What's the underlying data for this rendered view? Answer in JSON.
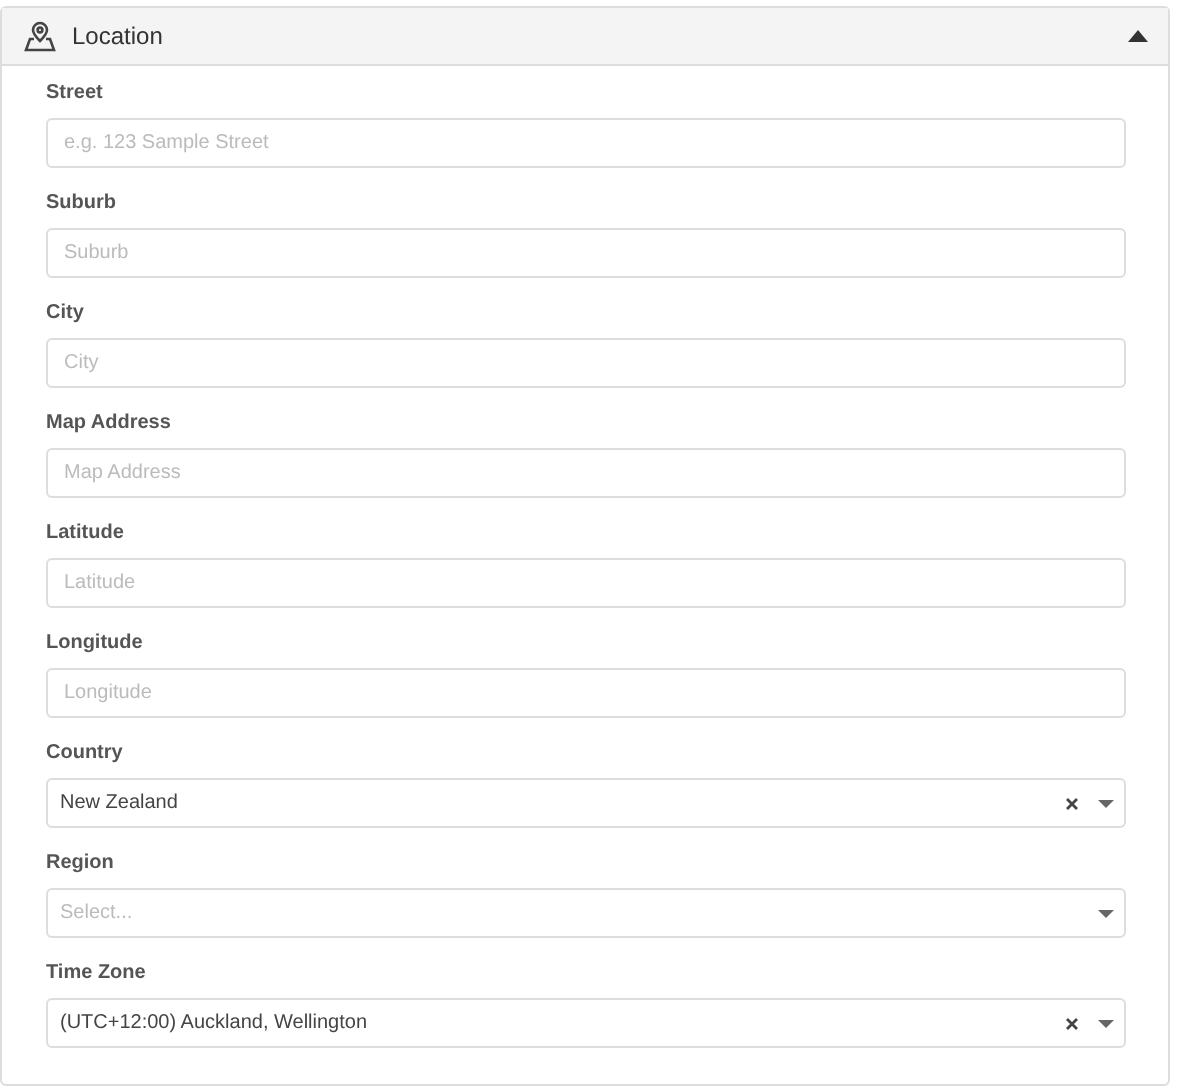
{
  "panel": {
    "title": "Location",
    "expanded": true
  },
  "fields": [
    {
      "kind": "text",
      "label": "Street",
      "placeholder": "e.g. 123 Sample Street"
    },
    {
      "kind": "text",
      "label": "Suburb",
      "placeholder": "Suburb"
    },
    {
      "kind": "text",
      "label": "City",
      "placeholder": "City"
    },
    {
      "kind": "text",
      "label": "Map Address",
      "placeholder": "Map Address"
    },
    {
      "kind": "text",
      "label": "Latitude",
      "placeholder": "Latitude"
    },
    {
      "kind": "text",
      "label": "Longitude",
      "placeholder": "Longitude"
    },
    {
      "kind": "select",
      "label": "Country",
      "value": "New Zealand",
      "clearable": true
    },
    {
      "kind": "select",
      "label": "Region",
      "placeholder": "Select...",
      "clearable": false
    },
    {
      "kind": "select",
      "label": "Time Zone",
      "value": "(UTC+12:00) Auckland, Wellington",
      "clearable": true
    }
  ]
}
